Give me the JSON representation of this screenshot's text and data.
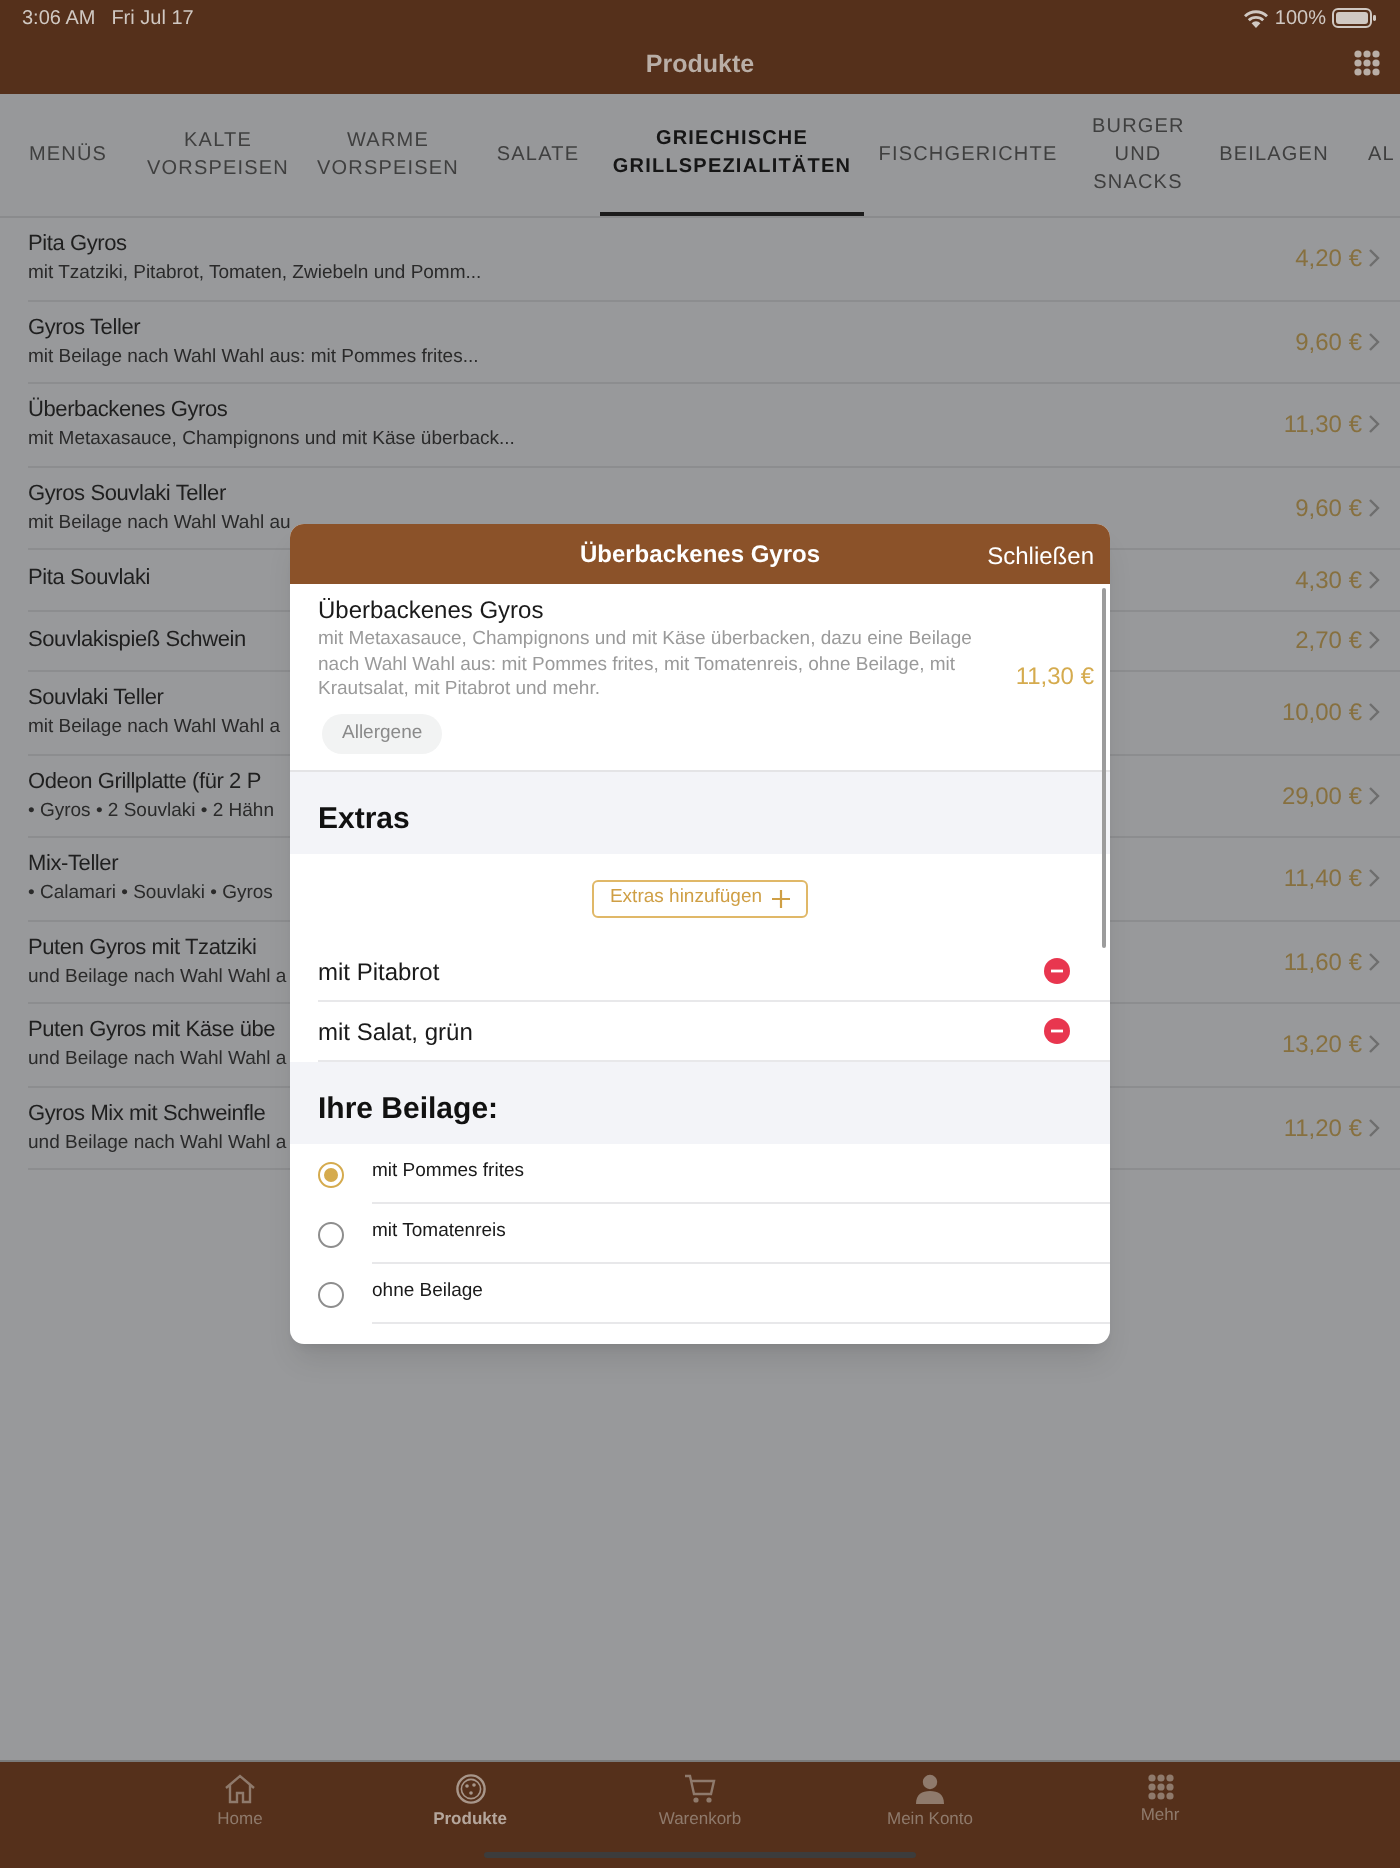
{
  "status_bar": {
    "time": "3:06 AM",
    "date": "Fri Jul 17",
    "battery": "100%"
  },
  "nav_bar": {
    "title": "Produkte"
  },
  "category_tabs": [
    {
      "label": "MENÜS",
      "selected": false
    },
    {
      "label": "KALTE VORSPEISEN",
      "selected": false
    },
    {
      "label": "WARME VORSPEISEN",
      "selected": false
    },
    {
      "label": "SALATE",
      "selected": false
    },
    {
      "label": "GRIECHISCHE GRILLSPEZIALITÄTEN",
      "selected": true
    },
    {
      "label": "FISCHGERICHTE",
      "selected": false
    },
    {
      "label": "BURGER UND SNACKS",
      "selected": false
    },
    {
      "label": "BEILAGEN",
      "selected": false
    },
    {
      "label": "AL",
      "selected": false
    }
  ],
  "products": [
    {
      "name": "Pita Gyros",
      "description": "mit Tzatziki, Pitabrot, Tomaten, Zwiebeln und Pomm...",
      "price": "4,20 €"
    },
    {
      "name": "Gyros Teller",
      "description": "mit Beilage nach Wahl Wahl aus: mit Pommes frites...",
      "price": "9,60 €"
    },
    {
      "name": "Überbackenes Gyros",
      "description": "mit Metaxasauce, Champignons und mit Käse überback...",
      "price": "11,30 €"
    },
    {
      "name": "Gyros Souvlaki Teller",
      "description": "mit Beilage nach Wahl Wahl au",
      "price": "9,60 €"
    },
    {
      "name": "Pita Souvlaki",
      "price": "4,30 €"
    },
    {
      "name": "Souvlakispieß Schwein",
      "price": "2,70 €"
    },
    {
      "name": "Souvlaki Teller",
      "description": "mit Beilage nach Wahl Wahl a",
      "price": "10,00 €"
    },
    {
      "name": "Odeon Grillplatte (für 2 P",
      "description": "• Gyros • 2 Souvlaki • 2 Hähn",
      "price": "29,00 €"
    },
    {
      "name": "Mix-Teller",
      "description": "• Calamari • Souvlaki • Gyros",
      "price": "11,40 €"
    },
    {
      "name": "Puten Gyros mit Tzatziki",
      "description": "und Beilage nach Wahl Wahl a",
      "price": "11,60 €"
    },
    {
      "name": "Puten Gyros mit Käse übe",
      "description": "und Beilage nach Wahl Wahl a",
      "price": "13,20 €"
    },
    {
      "name": "Gyros Mix mit Schweinfle",
      "description": "und Beilage nach Wahl Wahl a",
      "price": "11,20 €"
    }
  ],
  "dialog": {
    "title": "Überbackenes Gyros",
    "close": "Schließen",
    "product": {
      "name": "Überbackenes Gyros",
      "description": "mit Metaxasauce, Champignons und mit Käse überbacken, dazu eine Beilage nach Wahl Wahl aus: mit Pommes frites, mit Tomatenreis, ohne Beilage, mit Krautsalat, mit Pitabrot und mehr.",
      "price": "11,30 €",
      "allergens_button": "Allergene"
    },
    "extras": {
      "heading": "Extras",
      "add_button": "Extras hinzufügen",
      "items": [
        "mit Pitabrot",
        "mit Salat, grün"
      ]
    },
    "side": {
      "heading": "Ihre Beilage:",
      "options": [
        {
          "label": "mit Pommes frites",
          "selected": true
        },
        {
          "label": "mit Tomatenreis",
          "selected": false
        },
        {
          "label": "ohne Beilage",
          "selected": false
        }
      ]
    }
  },
  "tab_bar": [
    {
      "kind": "home",
      "label": "Home",
      "selected": false
    },
    {
      "kind": "products",
      "label": "Produkte",
      "selected": true
    },
    {
      "kind": "cart",
      "label": "Warenkorb",
      "selected": false
    },
    {
      "kind": "account",
      "label": "Mein Konto",
      "selected": false
    },
    {
      "kind": "more",
      "label": "Mehr",
      "selected": false
    }
  ]
}
